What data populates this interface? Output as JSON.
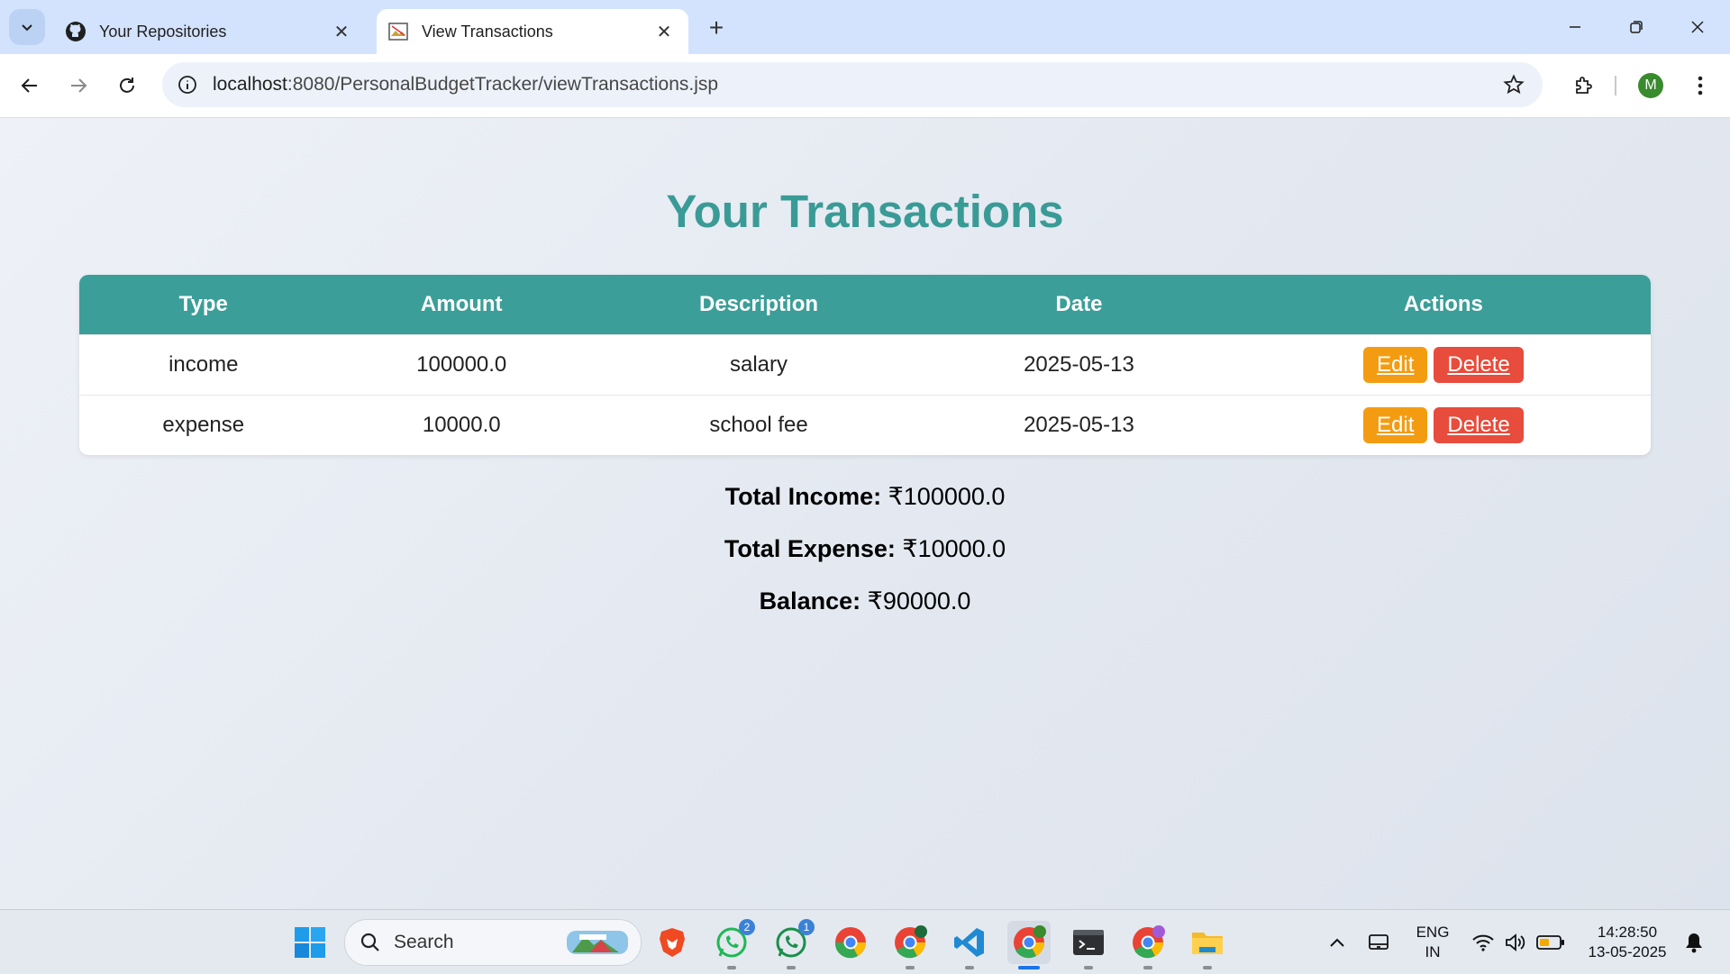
{
  "browser": {
    "tabs": [
      {
        "title": "Your Repositories",
        "icon": "github-icon",
        "active": false
      },
      {
        "title": "View Transactions",
        "icon": "broken-image-icon",
        "active": true
      }
    ],
    "url_host": "localhost",
    "url_rest": ":8080/PersonalBudgetTracker/viewTransactions.jsp",
    "profile_initial": "M"
  },
  "page": {
    "title": "Your Transactions",
    "table": {
      "headers": [
        "Type",
        "Amount",
        "Description",
        "Date",
        "Actions"
      ],
      "rows": [
        {
          "type": "income",
          "amount": "100000.0",
          "description": "salary",
          "date": "2025-05-13",
          "edit": "Edit",
          "delete": "Delete"
        },
        {
          "type": "expense",
          "amount": "10000.0",
          "description": "school fee",
          "date": "2025-05-13",
          "edit": "Edit",
          "delete": "Delete"
        }
      ]
    },
    "summary": {
      "income_label": "Total Income:",
      "income_value": "₹100000.0",
      "expense_label": "Total Expense:",
      "expense_value": "₹10000.0",
      "balance_label": "Balance:",
      "balance_value": "₹90000.0"
    },
    "colors": {
      "accent": "#3c9e98",
      "edit": "#f39c12",
      "delete": "#e74c3c"
    }
  },
  "taskbar": {
    "search_label": "Search",
    "whatsapp_badge": "2",
    "whatsapp_beta_badge": "1",
    "language": "ENG",
    "region": "IN",
    "time": "14:28:50",
    "date": "13-05-2025"
  }
}
